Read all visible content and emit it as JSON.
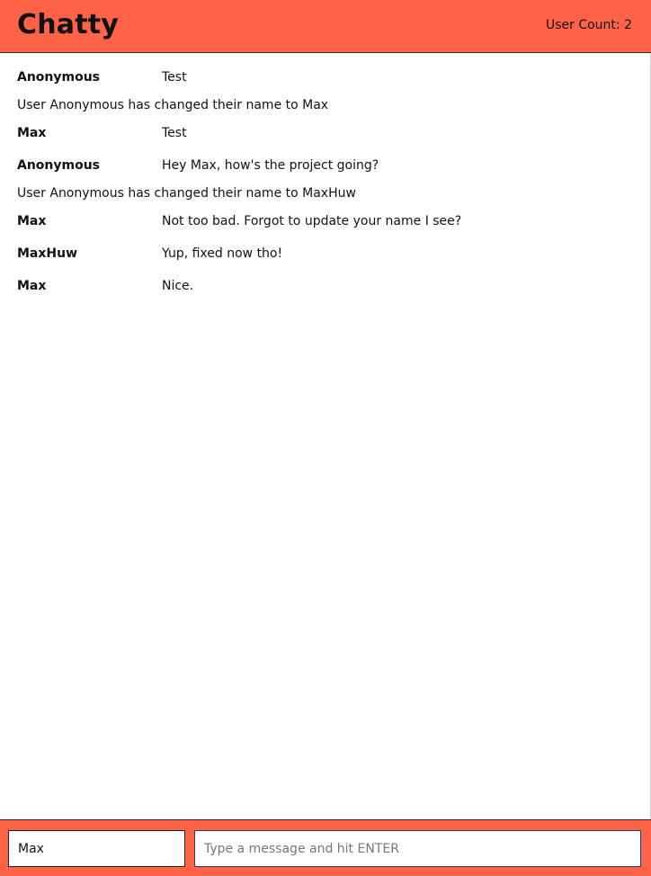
{
  "navbar": {
    "brand": "Chatty",
    "user_count": "User Count: 2",
    "background_color": "#ff6347"
  },
  "messages": [
    {
      "type": "message",
      "username": "Anonymous",
      "content": "Test"
    },
    {
      "type": "notification",
      "content": "User Anonymous has changed their name to Max"
    },
    {
      "type": "message",
      "username": "Max",
      "content": "Test"
    },
    {
      "type": "message",
      "username": "Anonymous",
      "content": "Hey Max, how's the project going?"
    },
    {
      "type": "notification",
      "content": "User Anonymous has changed their name to MaxHuw"
    },
    {
      "type": "message",
      "username": "Max",
      "content": "Not too bad. Forgot to update your name I see?"
    },
    {
      "type": "message",
      "username": "MaxHuw",
      "content": "Yup, fixed now tho!"
    },
    {
      "type": "message",
      "username": "Max",
      "content": "Nice."
    }
  ],
  "chatbar": {
    "username_value": "Max",
    "message_placeholder": "Type a message and hit ENTER",
    "message_value": ""
  }
}
